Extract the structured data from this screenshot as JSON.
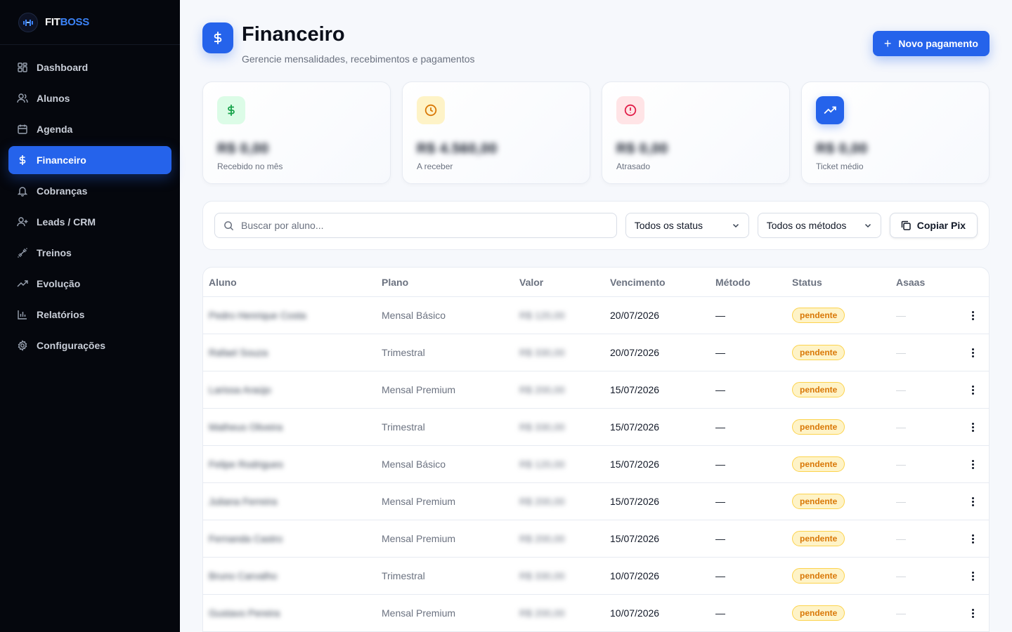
{
  "brand": {
    "name_a": "FIT",
    "name_b": "BOSS"
  },
  "sidebar": {
    "items": [
      {
        "label": "Dashboard",
        "icon": "grid-icon"
      },
      {
        "label": "Alunos",
        "icon": "users-icon"
      },
      {
        "label": "Agenda",
        "icon": "calendar-icon"
      },
      {
        "label": "Financeiro",
        "icon": "dollar-icon",
        "active": true
      },
      {
        "label": "Cobranças",
        "icon": "bell-icon"
      },
      {
        "label": "Leads / CRM",
        "icon": "user-plus-icon"
      },
      {
        "label": "Treinos",
        "icon": "dumbbell-icon"
      },
      {
        "label": "Evolução",
        "icon": "trending-up-icon"
      },
      {
        "label": "Relatórios",
        "icon": "bar-chart-icon"
      },
      {
        "label": "Configurações",
        "icon": "gear-icon"
      }
    ]
  },
  "header": {
    "title": "Financeiro",
    "subtitle": "Gerencie mensalidades, recebimentos e pagamentos",
    "new_button": "Novo pagamento"
  },
  "stats": [
    {
      "value": "R$ 0,00",
      "label": "Recebido no mês",
      "icon": "dollar-icon",
      "color": "#16a34a",
      "bg": "#dcfce7"
    },
    {
      "value": "R$ 4.560,00",
      "label": "A receber",
      "icon": "clock-icon",
      "color": "#d97706",
      "bg": "#fef3c7"
    },
    {
      "value": "R$ 0,00",
      "label": "Atrasado",
      "icon": "alert-circle-icon",
      "color": "#e11d48",
      "bg": "#ffe4e6"
    },
    {
      "value": "R$ 0,00",
      "label": "Ticket médio",
      "icon": "trending-up-icon",
      "color": "#ffffff",
      "bg": "#2563eb"
    }
  ],
  "filters": {
    "search_placeholder": "Buscar por aluno...",
    "status_select": "Todos os status",
    "method_select": "Todos os métodos",
    "copy_pix": "Copiar Pix"
  },
  "table": {
    "columns": [
      "Aluno",
      "Plano",
      "Valor",
      "Vencimento",
      "Método",
      "Status",
      "Asaas"
    ],
    "rows": [
      {
        "aluno": "Pedro Henrique Costa",
        "plano": "Mensal Básico",
        "valor": "R$ 120,00",
        "vencimento": "20/07/2026",
        "metodo": "—",
        "status": "pendente",
        "asaas": "—"
      },
      {
        "aluno": "Rafael Souza",
        "plano": "Trimestral",
        "valor": "R$ 330,00",
        "vencimento": "20/07/2026",
        "metodo": "—",
        "status": "pendente",
        "asaas": "—"
      },
      {
        "aluno": "Larissa Araújo",
        "plano": "Mensal Premium",
        "valor": "R$ 200,00",
        "vencimento": "15/07/2026",
        "metodo": "—",
        "status": "pendente",
        "asaas": "—"
      },
      {
        "aluno": "Matheus Oliveira",
        "plano": "Trimestral",
        "valor": "R$ 330,00",
        "vencimento": "15/07/2026",
        "metodo": "—",
        "status": "pendente",
        "asaas": "—"
      },
      {
        "aluno": "Felipe Rodrigues",
        "plano": "Mensal Básico",
        "valor": "R$ 120,00",
        "vencimento": "15/07/2026",
        "metodo": "—",
        "status": "pendente",
        "asaas": "—"
      },
      {
        "aluno": "Juliana Ferreira",
        "plano": "Mensal Premium",
        "valor": "R$ 200,00",
        "vencimento": "15/07/2026",
        "metodo": "—",
        "status": "pendente",
        "asaas": "—"
      },
      {
        "aluno": "Fernanda Castro",
        "plano": "Mensal Premium",
        "valor": "R$ 200,00",
        "vencimento": "15/07/2026",
        "metodo": "—",
        "status": "pendente",
        "asaas": "—"
      },
      {
        "aluno": "Bruno Carvalho",
        "plano": "Trimestral",
        "valor": "R$ 330,00",
        "vencimento": "10/07/2026",
        "metodo": "—",
        "status": "pendente",
        "asaas": "—"
      },
      {
        "aluno": "Gustavo Pereira",
        "plano": "Mensal Premium",
        "valor": "R$ 200,00",
        "vencimento": "10/07/2026",
        "metodo": "—",
        "status": "pendente",
        "asaas": "—"
      }
    ]
  }
}
